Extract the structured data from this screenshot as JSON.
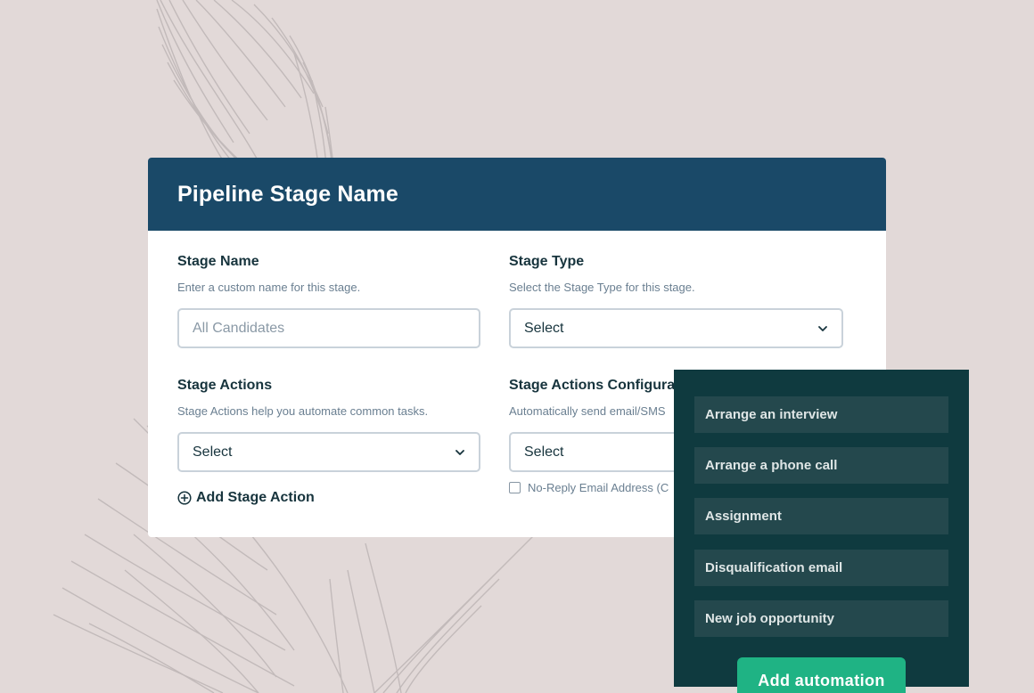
{
  "card": {
    "title": "Pipeline Stage Name"
  },
  "stage_name": {
    "label": "Stage Name",
    "help": "Enter a custom name for this stage.",
    "value": "All Candidates"
  },
  "stage_type": {
    "label": "Stage Type",
    "help": "Select the Stage Type for this stage.",
    "value": "Select"
  },
  "stage_actions": {
    "label": "Stage Actions",
    "help": "Stage Actions help you automate common tasks.",
    "value": "Select",
    "add_label": "Add Stage Action"
  },
  "stage_actions_config": {
    "label": "Stage Actions Configurat",
    "help": "Automatically send email/SMS",
    "value": "Select",
    "checkbox_label": "No-Reply Email Address (C"
  },
  "automation_menu": {
    "options": [
      "Arrange an interview",
      "Arrange a phone call",
      "Assignment",
      "Disqualification email",
      "New job opportunity"
    ],
    "button_label": "Add automation"
  },
  "colors": {
    "header": "#1a4968",
    "panel": "#0f3a3f",
    "accent": "#1fb384",
    "background": "#e2d9d8"
  }
}
